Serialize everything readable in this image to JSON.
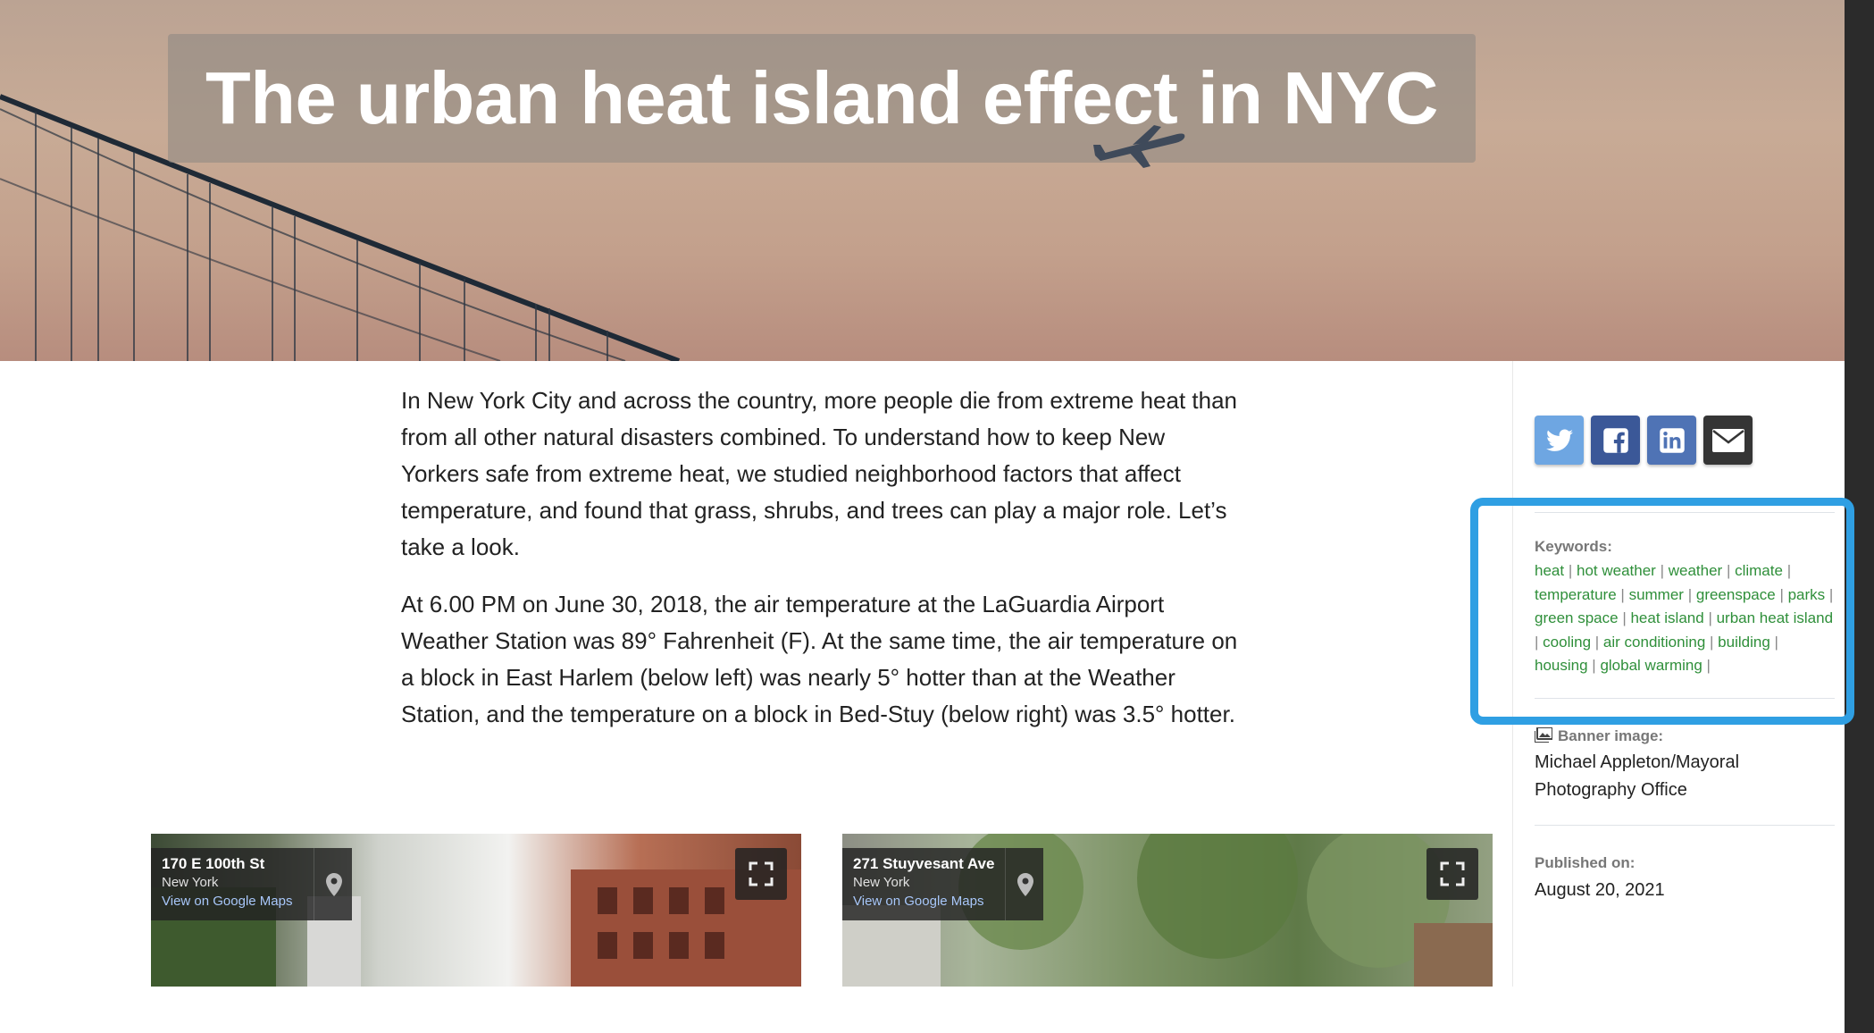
{
  "banner": {
    "title": "The urban heat island effect in NYC"
  },
  "article": {
    "paragraphs": [
      "In New York City and across the country, more people die from extreme heat than from all other natural disasters combined. To understand how to keep New Yorkers safe from extreme heat, we studied neighborhood factors that affect temperature, and found that grass, shrubs, and trees can play a major role. Let’s take a look.",
      "At 6.00 PM on June 30, 2018, the air temperature at the LaGuardia Airport Weather Station was 89° Fahrenheit (F). At the same time, the air temperature on a block in East Harlem (below left) was nearly 5° hotter than at the Weather Station, and the temperature on a block in Bed-Stuy (below right) was 3.5° hotter."
    ]
  },
  "streetviews": [
    {
      "street": "170 E 100th St",
      "city": "New York",
      "link": "View on Google Maps"
    },
    {
      "street": "271 Stuyvesant Ave",
      "city": "New York",
      "link": "View on Google Maps"
    }
  ],
  "share": {
    "buttons": [
      {
        "icon": "twitter-icon",
        "color": "#6ea6e2"
      },
      {
        "icon": "facebook-icon",
        "color": "#3b5898"
      },
      {
        "icon": "linkedin-icon",
        "color": "#4f73b5"
      },
      {
        "icon": "email-icon",
        "color": "#353535"
      }
    ]
  },
  "keywords": {
    "label": "Keywords:",
    "items": [
      "heat",
      "hot weather",
      "weather",
      "climate",
      "temperature",
      "summer",
      "greenspace",
      "parks",
      "green space",
      "heat island",
      "urban heat island",
      "cooling",
      "air conditioning",
      "building",
      "housing",
      "global warming"
    ],
    "separator": "|",
    "highlight_color": "#2f9fe3",
    "link_color": "#2f8f3a"
  },
  "banner_credit": {
    "label": "Banner image:",
    "value": "Michael Appleton/Mayoral Photography Office"
  },
  "published": {
    "label": "Published on:",
    "value": "August 20, 2021"
  }
}
